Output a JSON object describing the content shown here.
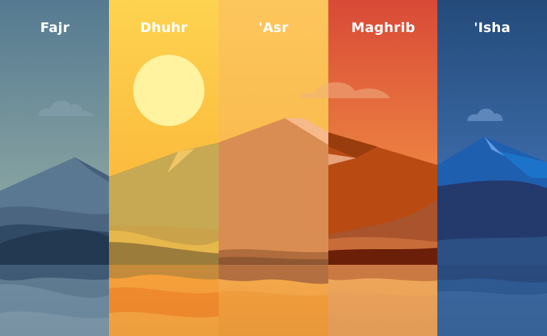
{
  "panels": [
    {
      "label": "Fajr"
    },
    {
      "label": "Dhuhr"
    },
    {
      "label": "'Asr"
    },
    {
      "label": "Maghrib"
    },
    {
      "label": "'Isha"
    }
  ]
}
